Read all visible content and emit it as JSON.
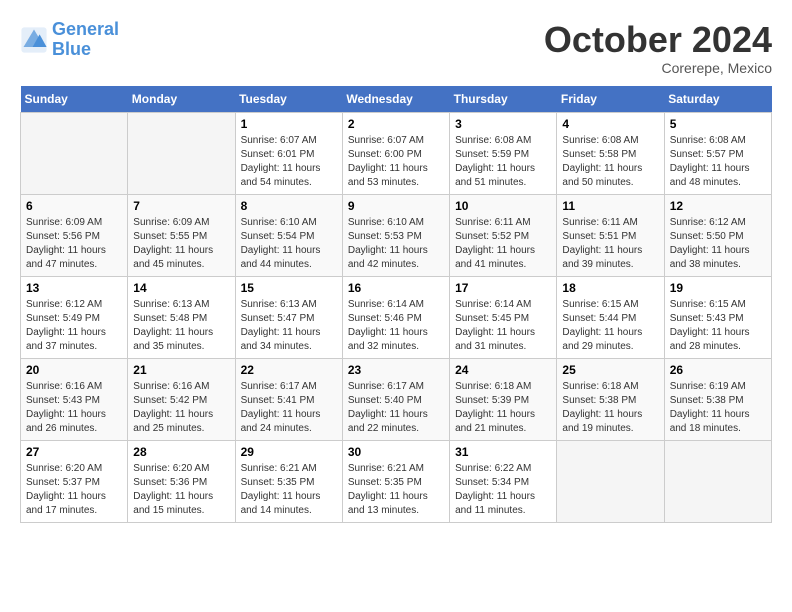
{
  "header": {
    "logo_line1": "General",
    "logo_line2": "Blue",
    "month": "October 2024",
    "location": "Corerepe, Mexico"
  },
  "days_of_week": [
    "Sunday",
    "Monday",
    "Tuesday",
    "Wednesday",
    "Thursday",
    "Friday",
    "Saturday"
  ],
  "weeks": [
    [
      {
        "day": "",
        "empty": true
      },
      {
        "day": "",
        "empty": true
      },
      {
        "day": "1",
        "sunrise": "6:07 AM",
        "sunset": "6:01 PM",
        "daylight": "11 hours and 54 minutes."
      },
      {
        "day": "2",
        "sunrise": "6:07 AM",
        "sunset": "6:00 PM",
        "daylight": "11 hours and 53 minutes."
      },
      {
        "day": "3",
        "sunrise": "6:08 AM",
        "sunset": "5:59 PM",
        "daylight": "11 hours and 51 minutes."
      },
      {
        "day": "4",
        "sunrise": "6:08 AM",
        "sunset": "5:58 PM",
        "daylight": "11 hours and 50 minutes."
      },
      {
        "day": "5",
        "sunrise": "6:08 AM",
        "sunset": "5:57 PM",
        "daylight": "11 hours and 48 minutes."
      }
    ],
    [
      {
        "day": "6",
        "sunrise": "6:09 AM",
        "sunset": "5:56 PM",
        "daylight": "11 hours and 47 minutes."
      },
      {
        "day": "7",
        "sunrise": "6:09 AM",
        "sunset": "5:55 PM",
        "daylight": "11 hours and 45 minutes."
      },
      {
        "day": "8",
        "sunrise": "6:10 AM",
        "sunset": "5:54 PM",
        "daylight": "11 hours and 44 minutes."
      },
      {
        "day": "9",
        "sunrise": "6:10 AM",
        "sunset": "5:53 PM",
        "daylight": "11 hours and 42 minutes."
      },
      {
        "day": "10",
        "sunrise": "6:11 AM",
        "sunset": "5:52 PM",
        "daylight": "11 hours and 41 minutes."
      },
      {
        "day": "11",
        "sunrise": "6:11 AM",
        "sunset": "5:51 PM",
        "daylight": "11 hours and 39 minutes."
      },
      {
        "day": "12",
        "sunrise": "6:12 AM",
        "sunset": "5:50 PM",
        "daylight": "11 hours and 38 minutes."
      }
    ],
    [
      {
        "day": "13",
        "sunrise": "6:12 AM",
        "sunset": "5:49 PM",
        "daylight": "11 hours and 37 minutes."
      },
      {
        "day": "14",
        "sunrise": "6:13 AM",
        "sunset": "5:48 PM",
        "daylight": "11 hours and 35 minutes."
      },
      {
        "day": "15",
        "sunrise": "6:13 AM",
        "sunset": "5:47 PM",
        "daylight": "11 hours and 34 minutes."
      },
      {
        "day": "16",
        "sunrise": "6:14 AM",
        "sunset": "5:46 PM",
        "daylight": "11 hours and 32 minutes."
      },
      {
        "day": "17",
        "sunrise": "6:14 AM",
        "sunset": "5:45 PM",
        "daylight": "11 hours and 31 minutes."
      },
      {
        "day": "18",
        "sunrise": "6:15 AM",
        "sunset": "5:44 PM",
        "daylight": "11 hours and 29 minutes."
      },
      {
        "day": "19",
        "sunrise": "6:15 AM",
        "sunset": "5:43 PM",
        "daylight": "11 hours and 28 minutes."
      }
    ],
    [
      {
        "day": "20",
        "sunrise": "6:16 AM",
        "sunset": "5:43 PM",
        "daylight": "11 hours and 26 minutes."
      },
      {
        "day": "21",
        "sunrise": "6:16 AM",
        "sunset": "5:42 PM",
        "daylight": "11 hours and 25 minutes."
      },
      {
        "day": "22",
        "sunrise": "6:17 AM",
        "sunset": "5:41 PM",
        "daylight": "11 hours and 24 minutes."
      },
      {
        "day": "23",
        "sunrise": "6:17 AM",
        "sunset": "5:40 PM",
        "daylight": "11 hours and 22 minutes."
      },
      {
        "day": "24",
        "sunrise": "6:18 AM",
        "sunset": "5:39 PM",
        "daylight": "11 hours and 21 minutes."
      },
      {
        "day": "25",
        "sunrise": "6:18 AM",
        "sunset": "5:38 PM",
        "daylight": "11 hours and 19 minutes."
      },
      {
        "day": "26",
        "sunrise": "6:19 AM",
        "sunset": "5:38 PM",
        "daylight": "11 hours and 18 minutes."
      }
    ],
    [
      {
        "day": "27",
        "sunrise": "6:20 AM",
        "sunset": "5:37 PM",
        "daylight": "11 hours and 17 minutes."
      },
      {
        "day": "28",
        "sunrise": "6:20 AM",
        "sunset": "5:36 PM",
        "daylight": "11 hours and 15 minutes."
      },
      {
        "day": "29",
        "sunrise": "6:21 AM",
        "sunset": "5:35 PM",
        "daylight": "11 hours and 14 minutes."
      },
      {
        "day": "30",
        "sunrise": "6:21 AM",
        "sunset": "5:35 PM",
        "daylight": "11 hours and 13 minutes."
      },
      {
        "day": "31",
        "sunrise": "6:22 AM",
        "sunset": "5:34 PM",
        "daylight": "11 hours and 11 minutes."
      },
      {
        "day": "",
        "empty": true
      },
      {
        "day": "",
        "empty": true
      }
    ]
  ]
}
